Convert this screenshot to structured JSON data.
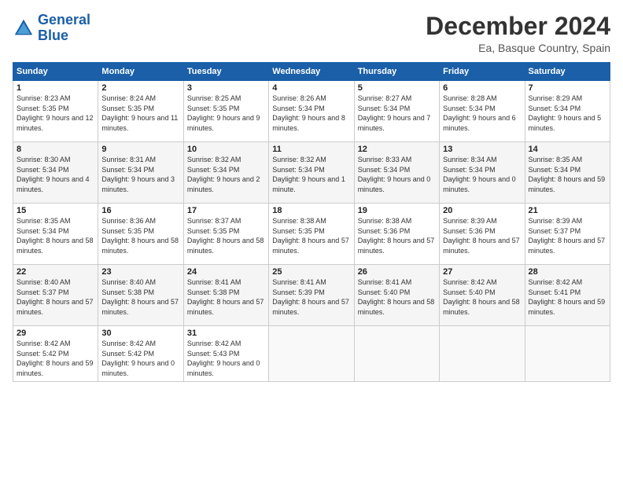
{
  "logo": {
    "line1": "General",
    "line2": "Blue"
  },
  "header": {
    "month": "December 2024",
    "location": "Ea, Basque Country, Spain"
  },
  "weekdays": [
    "Sunday",
    "Monday",
    "Tuesday",
    "Wednesday",
    "Thursday",
    "Friday",
    "Saturday"
  ],
  "weeks": [
    [
      {
        "day": "1",
        "sunrise": "8:23 AM",
        "sunset": "5:35 PM",
        "daylight": "9 hours and 12 minutes."
      },
      {
        "day": "2",
        "sunrise": "8:24 AM",
        "sunset": "5:35 PM",
        "daylight": "9 hours and 11 minutes."
      },
      {
        "day": "3",
        "sunrise": "8:25 AM",
        "sunset": "5:35 PM",
        "daylight": "9 hours and 9 minutes."
      },
      {
        "day": "4",
        "sunrise": "8:26 AM",
        "sunset": "5:34 PM",
        "daylight": "9 hours and 8 minutes."
      },
      {
        "day": "5",
        "sunrise": "8:27 AM",
        "sunset": "5:34 PM",
        "daylight": "9 hours and 7 minutes."
      },
      {
        "day": "6",
        "sunrise": "8:28 AM",
        "sunset": "5:34 PM",
        "daylight": "9 hours and 6 minutes."
      },
      {
        "day": "7",
        "sunrise": "8:29 AM",
        "sunset": "5:34 PM",
        "daylight": "9 hours and 5 minutes."
      }
    ],
    [
      {
        "day": "8",
        "sunrise": "8:30 AM",
        "sunset": "5:34 PM",
        "daylight": "9 hours and 4 minutes."
      },
      {
        "day": "9",
        "sunrise": "8:31 AM",
        "sunset": "5:34 PM",
        "daylight": "9 hours and 3 minutes."
      },
      {
        "day": "10",
        "sunrise": "8:32 AM",
        "sunset": "5:34 PM",
        "daylight": "9 hours and 2 minutes."
      },
      {
        "day": "11",
        "sunrise": "8:32 AM",
        "sunset": "5:34 PM",
        "daylight": "9 hours and 1 minute."
      },
      {
        "day": "12",
        "sunrise": "8:33 AM",
        "sunset": "5:34 PM",
        "daylight": "9 hours and 0 minutes."
      },
      {
        "day": "13",
        "sunrise": "8:34 AM",
        "sunset": "5:34 PM",
        "daylight": "9 hours and 0 minutes."
      },
      {
        "day": "14",
        "sunrise": "8:35 AM",
        "sunset": "5:34 PM",
        "daylight": "8 hours and 59 minutes."
      }
    ],
    [
      {
        "day": "15",
        "sunrise": "8:35 AM",
        "sunset": "5:34 PM",
        "daylight": "8 hours and 58 minutes."
      },
      {
        "day": "16",
        "sunrise": "8:36 AM",
        "sunset": "5:35 PM",
        "daylight": "8 hours and 58 minutes."
      },
      {
        "day": "17",
        "sunrise": "8:37 AM",
        "sunset": "5:35 PM",
        "daylight": "8 hours and 58 minutes."
      },
      {
        "day": "18",
        "sunrise": "8:38 AM",
        "sunset": "5:35 PM",
        "daylight": "8 hours and 57 minutes."
      },
      {
        "day": "19",
        "sunrise": "8:38 AM",
        "sunset": "5:36 PM",
        "daylight": "8 hours and 57 minutes."
      },
      {
        "day": "20",
        "sunrise": "8:39 AM",
        "sunset": "5:36 PM",
        "daylight": "8 hours and 57 minutes."
      },
      {
        "day": "21",
        "sunrise": "8:39 AM",
        "sunset": "5:37 PM",
        "daylight": "8 hours and 57 minutes."
      }
    ],
    [
      {
        "day": "22",
        "sunrise": "8:40 AM",
        "sunset": "5:37 PM",
        "daylight": "8 hours and 57 minutes."
      },
      {
        "day": "23",
        "sunrise": "8:40 AM",
        "sunset": "5:38 PM",
        "daylight": "8 hours and 57 minutes."
      },
      {
        "day": "24",
        "sunrise": "8:41 AM",
        "sunset": "5:38 PM",
        "daylight": "8 hours and 57 minutes."
      },
      {
        "day": "25",
        "sunrise": "8:41 AM",
        "sunset": "5:39 PM",
        "daylight": "8 hours and 57 minutes."
      },
      {
        "day": "26",
        "sunrise": "8:41 AM",
        "sunset": "5:40 PM",
        "daylight": "8 hours and 58 minutes."
      },
      {
        "day": "27",
        "sunrise": "8:42 AM",
        "sunset": "5:40 PM",
        "daylight": "8 hours and 58 minutes."
      },
      {
        "day": "28",
        "sunrise": "8:42 AM",
        "sunset": "5:41 PM",
        "daylight": "8 hours and 59 minutes."
      }
    ],
    [
      {
        "day": "29",
        "sunrise": "8:42 AM",
        "sunset": "5:42 PM",
        "daylight": "8 hours and 59 minutes."
      },
      {
        "day": "30",
        "sunrise": "8:42 AM",
        "sunset": "5:42 PM",
        "daylight": "9 hours and 0 minutes."
      },
      {
        "day": "31",
        "sunrise": "8:42 AM",
        "sunset": "5:43 PM",
        "daylight": "9 hours and 0 minutes."
      },
      null,
      null,
      null,
      null
    ]
  ]
}
